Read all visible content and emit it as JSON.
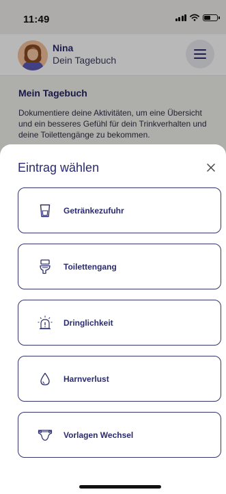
{
  "status_bar": {
    "time": "11:49"
  },
  "header": {
    "user_name": "Nina",
    "subtitle": "Dein Tagebuch"
  },
  "intro": {
    "title": "Mein Tagebuch",
    "text": "Dokumentiere deine Aktivitäten, um eine Übersicht und ein besseres Gefühl für dein Trinkverhalten und deine Toilettengänge zu bekommen."
  },
  "sheet": {
    "title": "Eintrag wählen",
    "options": [
      {
        "label": "Getränkezufuhr",
        "icon": "glass-icon"
      },
      {
        "label": "Toilettengang",
        "icon": "toilet-icon"
      },
      {
        "label": "Dringlichkeit",
        "icon": "alarm-icon"
      },
      {
        "label": "Harnverlust",
        "icon": "drop-icon"
      },
      {
        "label": "Vorlagen Wechsel",
        "icon": "diaper-icon"
      }
    ]
  },
  "colors": {
    "primary": "#2a2a6e",
    "border": "#33336e",
    "background": "#f0efec"
  }
}
